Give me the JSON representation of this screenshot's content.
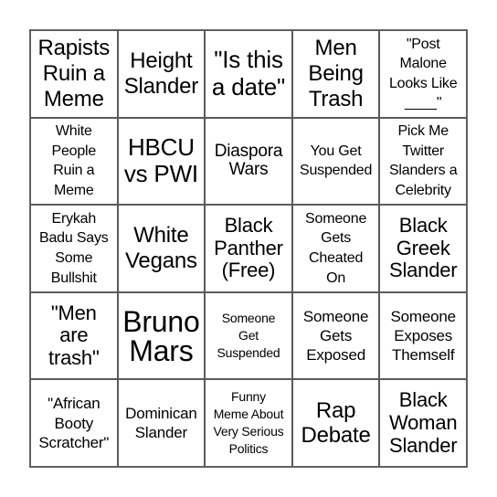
{
  "bingo": {
    "grid_size": 5,
    "border_color": "#5a5a5a",
    "rows": [
      [
        "Rapists\nRuin a\nMeme",
        "Height\nSlander",
        "\"Is this\na date\"",
        "Men\nBeing\nTrash",
        "\"Post\nMalone\nLooks Like\n____\""
      ],
      [
        "White\nPeople\nRuin a\nMeme",
        "HBCU\nvs PWI",
        "Diaspora\nWars",
        "You Get\nSuspended",
        "Pick Me\nTwitter\nSlanders a\nCelebrity"
      ],
      [
        "Erykah\nBadu Says\nSome\nBullshit",
        "White\nVegans",
        "Black\nPanther\n(Free)",
        "Someone\nGets\nCheated\nOn",
        "Black\nGreek\nSlander"
      ],
      [
        "\"Men\nare\ntrash\"",
        "Bruno\nMars",
        "Someone\nGet\nSuspended",
        "Someone\nGets\nExposed",
        "Someone\nExposes\nThemself"
      ],
      [
        "\"African\nBooty\nScratcher\"",
        "Dominican\nSlander",
        "Funny\nMeme About\nVery Serious\nPolitics",
        "Rap\nDebate",
        "Black\nWoman\nSlander"
      ]
    ]
  }
}
